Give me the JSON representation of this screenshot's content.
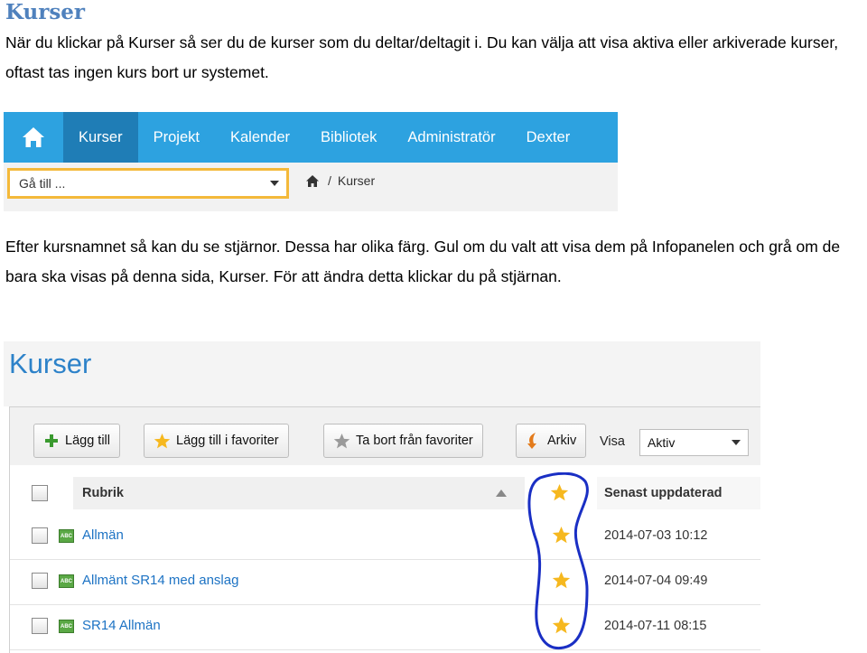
{
  "document": {
    "heading": "Kurser",
    "paragraph1": "När du klickar på Kurser så ser du de kurser som du deltar/deltagit i. Du kan välja att visa aktiva eller arkiverade kurser, oftast tas ingen kurs bort ur systemet.",
    "paragraph2": "Efter kursnamnet så kan du se stjärnor. Dessa har olika färg. Gul om du valt att visa dem på Infopanelen och grå om de bara ska visas på denna sida, Kurser. För att ändra detta klickar du på stjärnan."
  },
  "navigation": {
    "home_icon": "home-icon",
    "items": [
      {
        "label": "Kurser",
        "active": true
      },
      {
        "label": "Projekt",
        "active": false
      },
      {
        "label": "Kalender",
        "active": false
      },
      {
        "label": "Bibliotek",
        "active": false
      },
      {
        "label": "Administratör",
        "active": false
      },
      {
        "label": "Dexter",
        "active": false
      }
    ],
    "goto_label": "Gå till ...",
    "breadcrumb": {
      "separator": "/",
      "current": "Kurser"
    },
    "colors": {
      "bar": "#2da2e0",
      "active": "#1f7db6",
      "goto_border": "#f4b93a"
    }
  },
  "course_list": {
    "title": "Kurser",
    "toolbar": {
      "add_label": "Lägg till",
      "add_favorites_label": "Lägg till i favoriter",
      "remove_favorites_label": "Ta bort från favoriter",
      "archive_label": "Arkiv",
      "show_label": "Visa",
      "show_value": "Aktiv"
    },
    "columns": {
      "title": "Rubrik",
      "updated": "Senast uppdaterad"
    },
    "rows": [
      {
        "name": "Allmän",
        "updated": "2014-07-03 10:12",
        "favorite": true
      },
      {
        "name": "Allmänt SR14 med anslag",
        "updated": "2014-07-04 09:49",
        "favorite": true
      },
      {
        "name": "SR14 Allmän",
        "updated": "2014-07-11 08:15",
        "favorite": true
      }
    ],
    "colors": {
      "title": "#2d82c9",
      "link": "#1d73c4",
      "star": "#f6b81f",
      "annotation": "#1a2fc4"
    }
  }
}
